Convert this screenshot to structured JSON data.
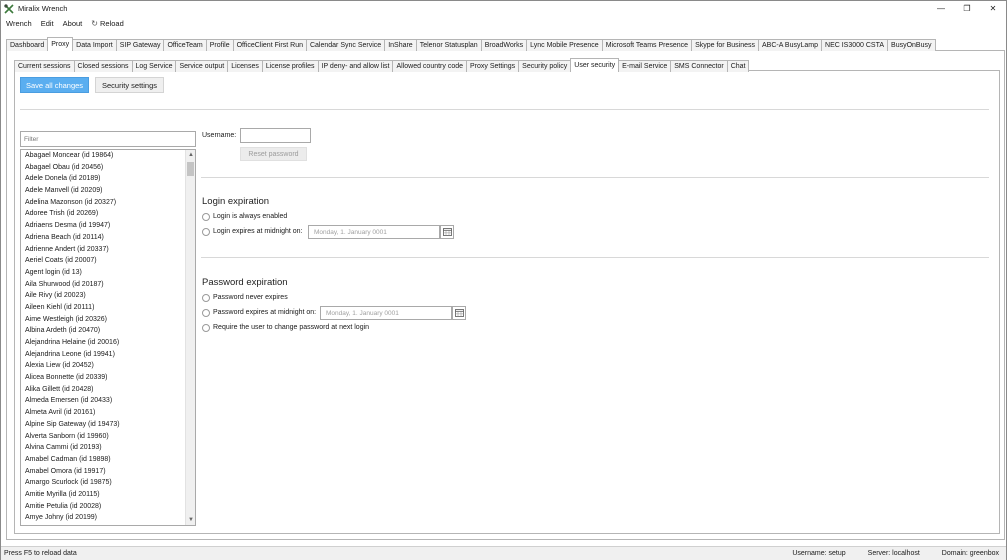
{
  "window": {
    "title": "Miralix Wrench"
  },
  "menu": {
    "items": [
      "Wrench",
      "Edit",
      "About"
    ],
    "reload_label": "Reload"
  },
  "main_tabs": [
    "Dashboard",
    "Proxy",
    "Data Import",
    "SIP Gateway",
    "OfficeTeam",
    "Profile",
    "OfficeClient First Run",
    "Calendar Sync Service",
    "InShare",
    "Telenor Statusplan",
    "BroadWorks",
    "Lync Mobile Presence",
    "Microsoft Teams Presence",
    "Skype for Business",
    "ABC-A BusyLamp",
    "NEC IS3000 CSTA",
    "BusyOnBusy"
  ],
  "main_active": 1,
  "sub_tabs": [
    "Current sessions",
    "Closed sessions",
    "Log Service",
    "Service output",
    "Licenses",
    "License profiles",
    "IP deny- and allow list",
    "Allowed country code",
    "Proxy Settings",
    "Security policy",
    "User security",
    "E-mail Service",
    "SMS Connector",
    "Chat"
  ],
  "sub_active": 10,
  "toolbar": {
    "save_label": "Save all changes",
    "security_label": "Security settings"
  },
  "filter": {
    "placeholder": "Filter"
  },
  "users": [
    "Abagael Moncear (id 19864)",
    "Abagael Obau (id 20456)",
    "Adele Donela (id 20189)",
    "Adele Manvell (id 20209)",
    "Adelina Mazonson (id 20327)",
    "Adoree Trish (id 20269)",
    "Adriaens Desma (id 19947)",
    "Adriena Beach (id 20114)",
    "Adrienne Andert (id 20337)",
    "Aeriel Coats (id 20007)",
    "Agent login (id 13)",
    "Aila Shurwood (id 20187)",
    "Aile Rivy (id 20023)",
    "Aileen Kiehl (id 20111)",
    "Aime Westleigh (id 20326)",
    "Albina Ardeth (id 20470)",
    "Alejandrina Helaine (id 20016)",
    "Alejandrina Leone (id 19941)",
    "Alexia Liew (id 20452)",
    "Alicea Bonnette (id 20339)",
    "Alika Gillett (id 20428)",
    "Almeda Emersen (id 20433)",
    "Almeta Avril (id 20161)",
    "Alpine Sip Gateway (id 19473)",
    "Alverta Sanborn (id 19960)",
    "Alvina Cammi (id 20193)",
    "Amabel Cadman (id 19898)",
    "Amabel Omora (id 19917)",
    "Amargo Scurlock (id 19875)",
    "Amitie Myrilla (id 20115)",
    "Amitie Petulia (id 20028)",
    "Amye Johny (id 20199)"
  ],
  "form": {
    "username_label": "Username:",
    "reset_label": "Reset password"
  },
  "login_exp": {
    "title": "Login expiration",
    "always": "Login is always enabled",
    "midnight": "Login expires at midnight on:",
    "date": "Monday, 1. January 0001"
  },
  "pwd_exp": {
    "title": "Password expiration",
    "never": "Password never expires",
    "midnight": "Password expires at midnight on:",
    "date": "Monday, 1. January 0001",
    "require": "Require the user to change password at next login"
  },
  "status": {
    "left": "Press F5 to reload data",
    "username": "Username: setup",
    "server": "Server: localhost",
    "domain": "Domain: greenbox"
  }
}
